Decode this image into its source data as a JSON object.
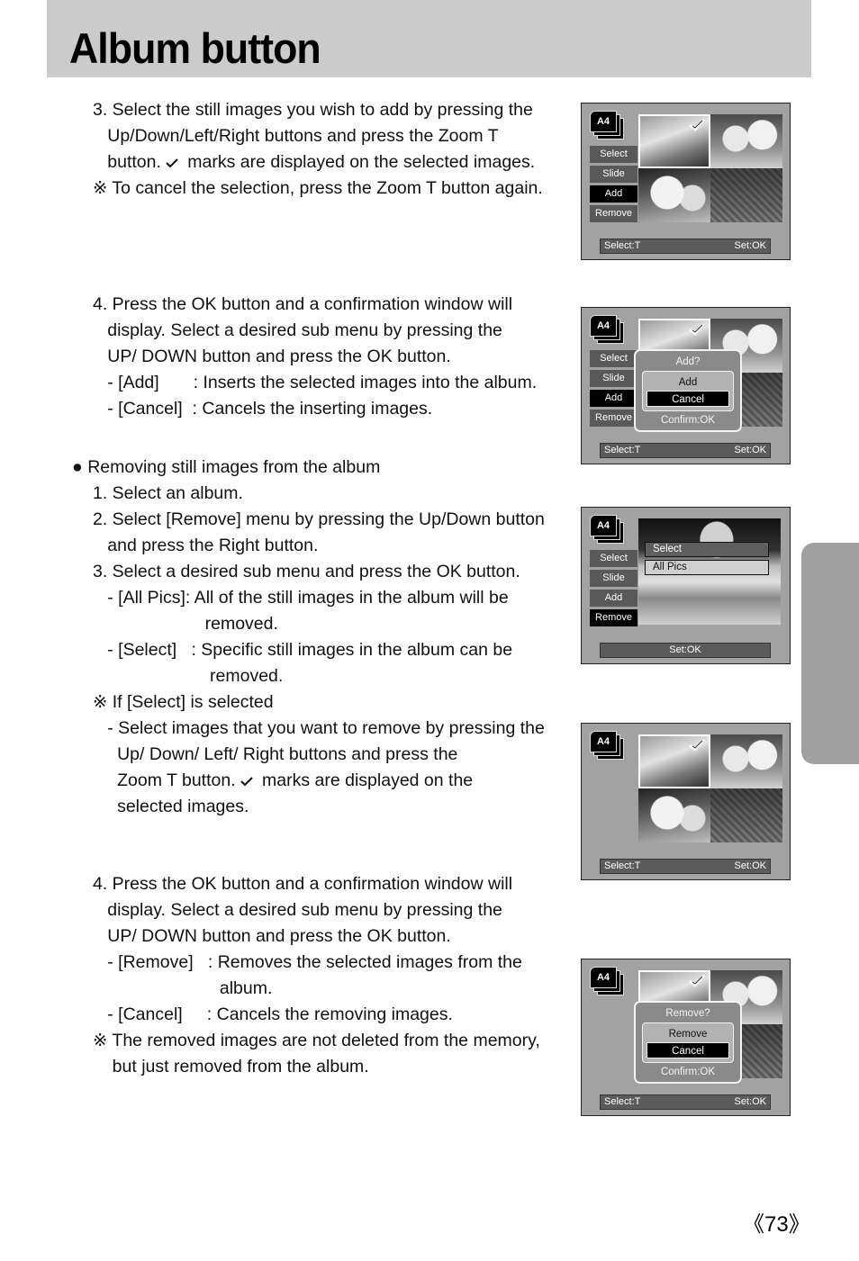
{
  "header": {
    "title": "Album button"
  },
  "instructions": {
    "step3_add": [
      "3. Select the still images you wish to add by pressing the",
      "   Up/Down/Left/Right buttons and press the Zoom T",
      "   button.",
      " marks are displayed on the selected images.",
      "※ To cancel the selection, press the Zoom T button again."
    ],
    "step4_add": [
      "4. Press the OK button and a confirmation window will",
      "   display. Select a desired sub menu by pressing the",
      "   UP/ DOWN button and press the OK button.",
      "   - [Add]       : Inserts the selected images into the album.",
      "   - [Cancel]  : Cancels the inserting images."
    ],
    "remove_section": {
      "bullet": "●",
      "heading": "Removing still images from the album",
      "lines": [
        "1. Select an album.",
        "2. Select [Remove] menu by pressing the Up/Down button",
        "   and press the Right button.",
        "3. Select a desired sub menu and press the OK button.",
        "   - [All Pics]: All of the still images in the album will be",
        "                       removed.",
        "   - [Select]   : Specific still images in the album can be",
        "                        removed.",
        "※ If [Select] is selected",
        "   - Select images that you want to remove by pressing the",
        "     Up/ Down/ Left/ Right buttons and press the",
        "     Zoom T button.",
        " marks are displayed on the",
        "     selected images."
      ]
    },
    "step4_remove": [
      "4. Press the OK button and a confirmation window will",
      "   display. Select a desired sub menu by pressing the",
      "   UP/ DOWN button and press the OK button.",
      "   - [Remove]   : Removes the selected images from the",
      "                          album.",
      "   - [Cancel]     : Cancels the removing images.",
      "※ The removed images are not deleted from the memory,",
      "    but just removed from the album."
    ]
  },
  "screens": {
    "album_label": "A4",
    "menu": [
      "Select",
      "Slide",
      "Add",
      "Remove"
    ],
    "status_left": "Select:T",
    "status_right": "Set:OK",
    "add_dialog": {
      "title": "Add?",
      "options": [
        "Add",
        "Cancel"
      ],
      "selected": "Cancel",
      "footer": "Confirm:OK"
    },
    "remove_submenu": {
      "options": [
        "Select",
        "All Pics"
      ],
      "highlighted": "All Pics",
      "status": "Set:OK"
    },
    "remove_dialog": {
      "title": "Remove?",
      "options": [
        "Remove",
        "Cancel"
      ],
      "selected": "Cancel",
      "footer": "Confirm:OK"
    }
  },
  "page_number": "《73》"
}
